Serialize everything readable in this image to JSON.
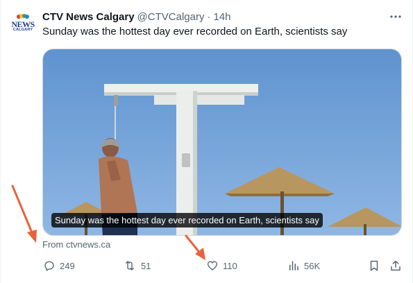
{
  "tweet": {
    "author_name": "CTV News Calgary",
    "author_handle": "@CTVCalgary",
    "separator": "·",
    "time": "14h",
    "text": "Sunday was the hottest day ever recorded on Earth, scientists say",
    "avatar": {
      "wordmark": "NEWS",
      "city": "CALGARY"
    }
  },
  "card": {
    "caption": "Sunday was the hottest day ever recorded on Earth, scientists say",
    "source": "From ctvnews.ca"
  },
  "actions": {
    "replies": "249",
    "reposts": "51",
    "likes": "110",
    "views": "56K"
  },
  "icons": {
    "more": "more-horizontal-icon",
    "reply": "reply-icon",
    "repost": "repost-icon",
    "like": "heart-icon",
    "views": "views-chart-icon",
    "bookmark": "bookmark-icon",
    "share": "share-icon"
  },
  "colors": {
    "text_primary": "#0f1419",
    "text_secondary": "#536471",
    "annotation_arrow": "#e8623c",
    "sky": "#6f9fd3"
  }
}
